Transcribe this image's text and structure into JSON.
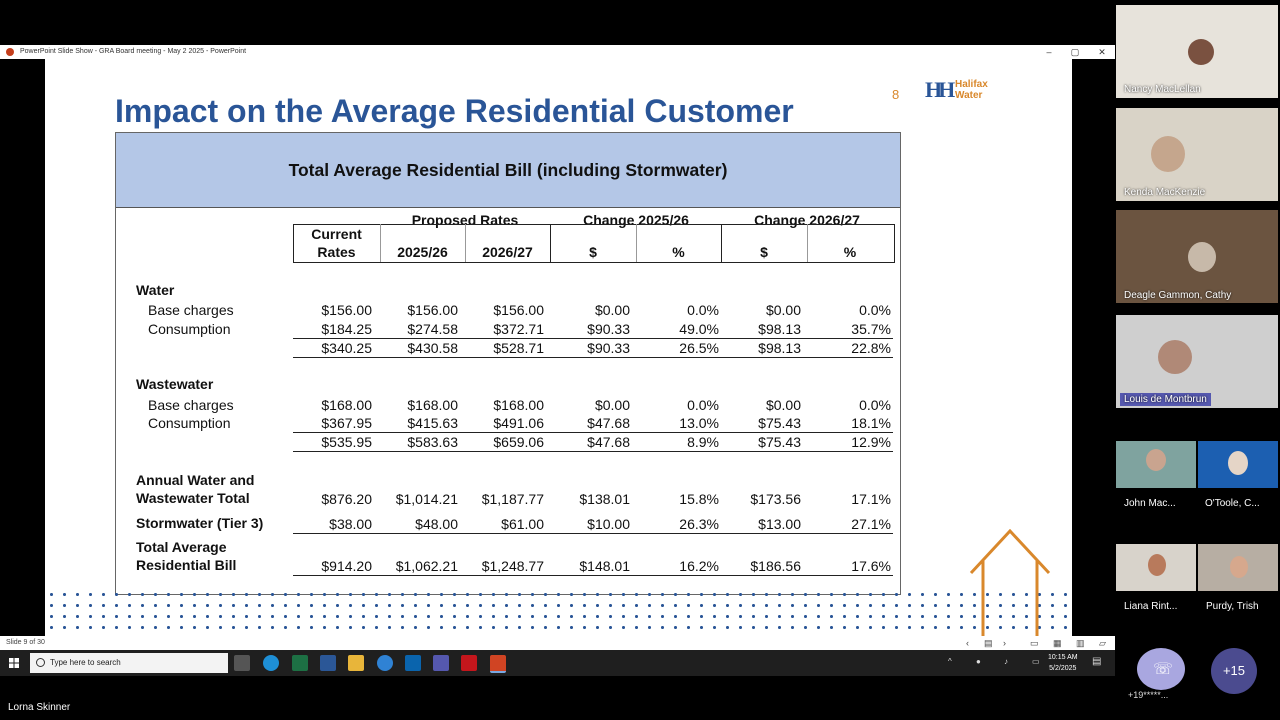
{
  "window": {
    "title": "PowerPoint Slide Show  -  GRA Board meeting - May 2 2025 - PowerPoint",
    "controls": [
      "–",
      "▢",
      "✕"
    ]
  },
  "slide": {
    "heading": "Impact on the Average Residential Customer",
    "page_number": "8",
    "logo_line1": "Halifax",
    "logo_line2": "Water",
    "table_title": "Total Average Residential Bill (including Stormwater)",
    "groups": {
      "proposed": "Proposed Rates",
      "change1": "Change 2025/26",
      "change2": "Change 2026/27"
    },
    "columns": {
      "current_1": "Current",
      "current_2": "Rates",
      "y2526": "2025/26",
      "y2627": "2026/27",
      "d1": "$",
      "p1": "%",
      "d2": "$",
      "p2": "%"
    },
    "sections": {
      "water": "Water",
      "wastewater": "Wastewater"
    },
    "rows": [
      {
        "label": "Base charges",
        "values": [
          "$156.00",
          "$156.00",
          "$156.00",
          "$0.00",
          "0.0%",
          "$0.00",
          "0.0%"
        ]
      },
      {
        "label": "Consumption",
        "values": [
          "$184.25",
          "$274.58",
          "$372.71",
          "$90.33",
          "49.0%",
          "$98.13",
          "35.7%"
        ]
      },
      {
        "label": "",
        "values": [
          "$340.25",
          "$430.58",
          "$528.71",
          "$90.33",
          "26.5%",
          "$98.13",
          "22.8%"
        ]
      },
      {
        "label": "Base charges",
        "values": [
          "$168.00",
          "$168.00",
          "$168.00",
          "$0.00",
          "0.0%",
          "$0.00",
          "0.0%"
        ]
      },
      {
        "label": "Consumption",
        "values": [
          "$367.95",
          "$415.63",
          "$491.06",
          "$47.68",
          "13.0%",
          "$75.43",
          "18.1%"
        ]
      },
      {
        "label": "",
        "values": [
          "$535.95",
          "$583.63",
          "$659.06",
          "$47.68",
          "8.9%",
          "$75.43",
          "12.9%"
        ]
      },
      {
        "label": "Annual Water and",
        "label2": "Wastewater Total",
        "values": [
          "$876.20",
          "$1,014.21",
          "$1,187.77",
          "$138.01",
          "15.8%",
          "$173.56",
          "17.1%"
        ]
      },
      {
        "label": "Stormwater (Tier 3)",
        "values": [
          "$38.00",
          "$48.00",
          "$61.00",
          "$10.00",
          "26.3%",
          "$13.00",
          "27.1%"
        ]
      },
      {
        "label": "Total Average",
        "label2": "Residential Bill",
        "values": [
          "$914.20",
          "$1,062.21",
          "$1,248.77",
          "$148.01",
          "16.2%",
          "$186.56",
          "17.6%"
        ]
      }
    ]
  },
  "status_bar": {
    "slide_counter": "Slide 9 of 30"
  },
  "taskbar": {
    "search_placeholder": "Type here to search",
    "time": "10:15 AM",
    "date": "5/2/2025"
  },
  "presenter_name": "Lorna Skinner",
  "participants": {
    "p1": "Nancy MacLellan",
    "p2": "Kenda MacKenzie",
    "p3": "Deagle Gammon, Cathy",
    "p4": "Louis de Montbrun",
    "p5": "John Mac...",
    "p6": "O'Toole, C...",
    "p7": "Liana Rint...",
    "p8": "Purdy, Trish",
    "more_count": "+15",
    "phone_label": "+19*****..."
  }
}
